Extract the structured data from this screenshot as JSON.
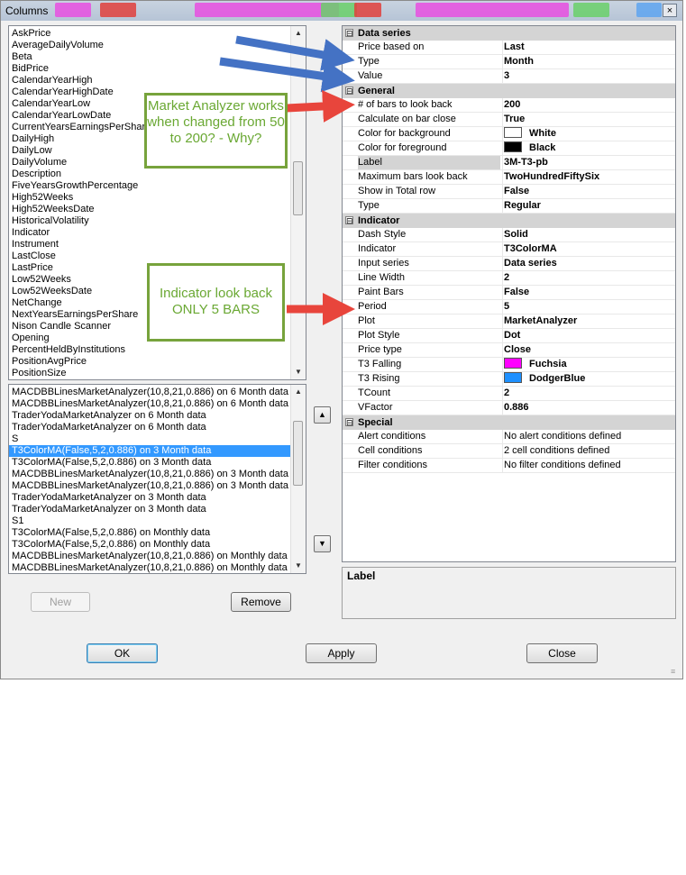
{
  "window": {
    "title": "Columns",
    "close_glyph": "×"
  },
  "available_columns": [
    "AskPrice",
    "AverageDailyVolume",
    "Beta",
    "BidPrice",
    "CalendarYearHigh",
    "CalendarYearHighDate",
    "CalendarYearLow",
    "CalendarYearLowDate",
    "CurrentYearsEarningsPerShare",
    "DailyHigh",
    "DailyLow",
    "DailyVolume",
    "Description",
    "FiveYearsGrowthPercentage",
    "High52Weeks",
    "High52WeeksDate",
    "HistoricalVolatility",
    "Indicator",
    "Instrument",
    "LastClose",
    "LastPrice",
    "Low52Weeks",
    "Low52WeeksDate",
    "NetChange",
    "NextYearsEarningsPerShare",
    "Nison Candle Scanner",
    "Opening",
    "PercentHeldByInstitutions",
    "PositionAvgPrice",
    "PositionSize"
  ],
  "selected_columns": [
    {
      "text": "MACDBBLinesMarketAnalyzer(10,8,21,0.886) on 6 Month data",
      "selected": false
    },
    {
      "text": "MACDBBLinesMarketAnalyzer(10,8,21,0.886) on 6 Month data",
      "selected": false
    },
    {
      "text": "TraderYodaMarketAnalyzer on 6 Month data",
      "selected": false
    },
    {
      "text": "TraderYodaMarketAnalyzer on 6 Month data",
      "selected": false
    },
    {
      "text": "S",
      "selected": false
    },
    {
      "text": "T3ColorMA(False,5,2,0.886) on 3 Month data",
      "selected": true
    },
    {
      "text": "T3ColorMA(False,5,2,0.886) on 3 Month data",
      "selected": false
    },
    {
      "text": "MACDBBLinesMarketAnalyzer(10,8,21,0.886) on 3 Month data",
      "selected": false
    },
    {
      "text": "MACDBBLinesMarketAnalyzer(10,8,21,0.886) on 3 Month data",
      "selected": false
    },
    {
      "text": "TraderYodaMarketAnalyzer on 3 Month data",
      "selected": false
    },
    {
      "text": "TraderYodaMarketAnalyzer on 3 Month data",
      "selected": false
    },
    {
      "text": "S1",
      "selected": false
    },
    {
      "text": "T3ColorMA(False,5,2,0.886) on Monthly data",
      "selected": false
    },
    {
      "text": "T3ColorMA(False,5,2,0.886) on Monthly data",
      "selected": false
    },
    {
      "text": "MACDBBLinesMarketAnalyzer(10,8,21,0.886) on Monthly data",
      "selected": false
    },
    {
      "text": "MACDBBLinesMarketAnalyzer(10,8,21,0.886) on Monthly data",
      "selected": false
    }
  ],
  "buttons": {
    "new": "New",
    "remove": "Remove",
    "ok": "OK",
    "apply": "Apply",
    "close": "Close"
  },
  "arrows": {
    "up": "▲",
    "down": "▼",
    "scroll_up": "▲",
    "scroll_down": "▼",
    "grip": "≡"
  },
  "property_grid": [
    {
      "category": "Data series",
      "collapse": "⊟",
      "rows": [
        {
          "name": "Price based on",
          "value": "Last"
        },
        {
          "name": "Type",
          "value": "Month"
        },
        {
          "name": "Value",
          "value": "3"
        }
      ]
    },
    {
      "category": "General",
      "collapse": "⊟",
      "rows": [
        {
          "name": "# of bars to look back",
          "value": "200"
        },
        {
          "name": "Calculate on bar close",
          "value": "True"
        },
        {
          "name": "Color for background",
          "value": "White",
          "swatch": "#ffffff"
        },
        {
          "name": "Color for foreground",
          "value": "Black",
          "swatch": "#000000"
        },
        {
          "name": "Label",
          "value": "3M-T3-pb",
          "selected": true
        },
        {
          "name": "Maximum bars look back",
          "value": "TwoHundredFiftySix"
        },
        {
          "name": "Show in Total row",
          "value": "False"
        },
        {
          "name": "Type",
          "value": "Regular"
        }
      ]
    },
    {
      "category": "Indicator",
      "collapse": "⊟",
      "rows": [
        {
          "name": "Dash Style",
          "value": "Solid"
        },
        {
          "name": "Indicator",
          "value": "T3ColorMA"
        },
        {
          "name": "Input series",
          "value": "Data series"
        },
        {
          "name": "Line Width",
          "value": "2"
        },
        {
          "name": "Paint Bars",
          "value": "False"
        },
        {
          "name": "Period",
          "value": "5"
        },
        {
          "name": "Plot",
          "value": "MarketAnalyzer"
        },
        {
          "name": "Plot Style",
          "value": "Dot"
        },
        {
          "name": "Price type",
          "value": "Close"
        },
        {
          "name": "T3 Falling",
          "value": "Fuchsia",
          "swatch": "#ff00ff"
        },
        {
          "name": "T3 Rising",
          "value": "DodgerBlue",
          "swatch": "#1e90ff"
        },
        {
          "name": "TCount",
          "value": "2"
        },
        {
          "name": "VFactor",
          "value": "0.886"
        }
      ]
    },
    {
      "category": "Special",
      "collapse": "⊟",
      "rows": [
        {
          "name": "Alert conditions",
          "value": "No alert conditions defined",
          "plain": true
        },
        {
          "name": "Cell conditions",
          "value": "2 cell conditions defined",
          "plain": true
        },
        {
          "name": "Filter conditions",
          "value": "No filter conditions defined",
          "plain": true
        }
      ]
    }
  ],
  "description": {
    "label": "Label"
  },
  "annotations": {
    "callout_market": "Market Analyzer works when changed from 50 to 200? - Why?",
    "callout_indicator": "Indicator look back ONLY 5 BARS"
  },
  "colors": {
    "arrow_blue": "#4472c4",
    "arrow_red": "#e8453c",
    "callout_green": "#77a33c"
  }
}
